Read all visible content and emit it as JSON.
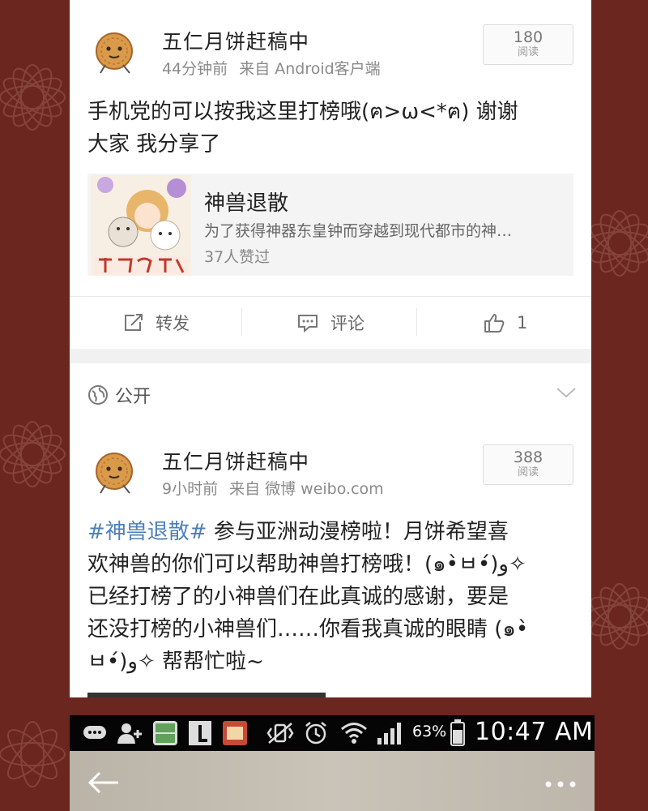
{
  "post1": {
    "username": "五仁月饼赶稿中",
    "time": "44分钟前",
    "source": "来自 Android客户端",
    "reads_count": "180",
    "reads_label": "阅读",
    "text_line1": "手机党的可以按我这里打榜哦(ฅ>ω<*ฅ) 谢谢",
    "text_line2": "大家 我分享了",
    "card": {
      "title": "神兽退散",
      "description": "为了获得神器东皇钟而穿越到现代都市的神…",
      "likes": "37人赞过"
    },
    "actions": {
      "repost": "转发",
      "comment": "评论",
      "like_count": "1"
    }
  },
  "visibility": "公开",
  "post2": {
    "username": "五仁月饼赶稿中",
    "time": "9小时前",
    "source": "来自 微博 weibo.com",
    "reads_count": "388",
    "reads_label": "阅读",
    "hashtag": "#神兽退散#",
    "text_line1_rest": " 参与亚洲动漫榜啦！月饼希望喜",
    "text_line2": "欢神兽的你们可以帮助神兽打榜哦！(๑•̀ㅂ•́)و✧",
    "text_line3": "已经打榜了的小神兽们在此真诚的感谢，要是",
    "text_line4": "还没打榜的小神兽们……你看我真诚的眼睛 (๑•̀",
    "text_line5": "ㅂ•́)و✧ 帮帮忙啦~"
  },
  "statusbar": {
    "battery": "63%",
    "time": "10:47 AM",
    "icons": [
      "chat-icon",
      "add-contact-icon",
      "comic-app-icon",
      "l-app-icon",
      "news-app-icon",
      "vibrate-icon",
      "alarm-icon",
      "wifi-icon",
      "signal-icon",
      "battery-icon"
    ]
  },
  "appbar": {
    "icons": [
      "back-arrow-icon",
      "more-options-icon"
    ]
  },
  "colors": {
    "background": "#6b2620",
    "hashtag": "#4d7fb8",
    "meta_text": "#8a8a8a"
  }
}
